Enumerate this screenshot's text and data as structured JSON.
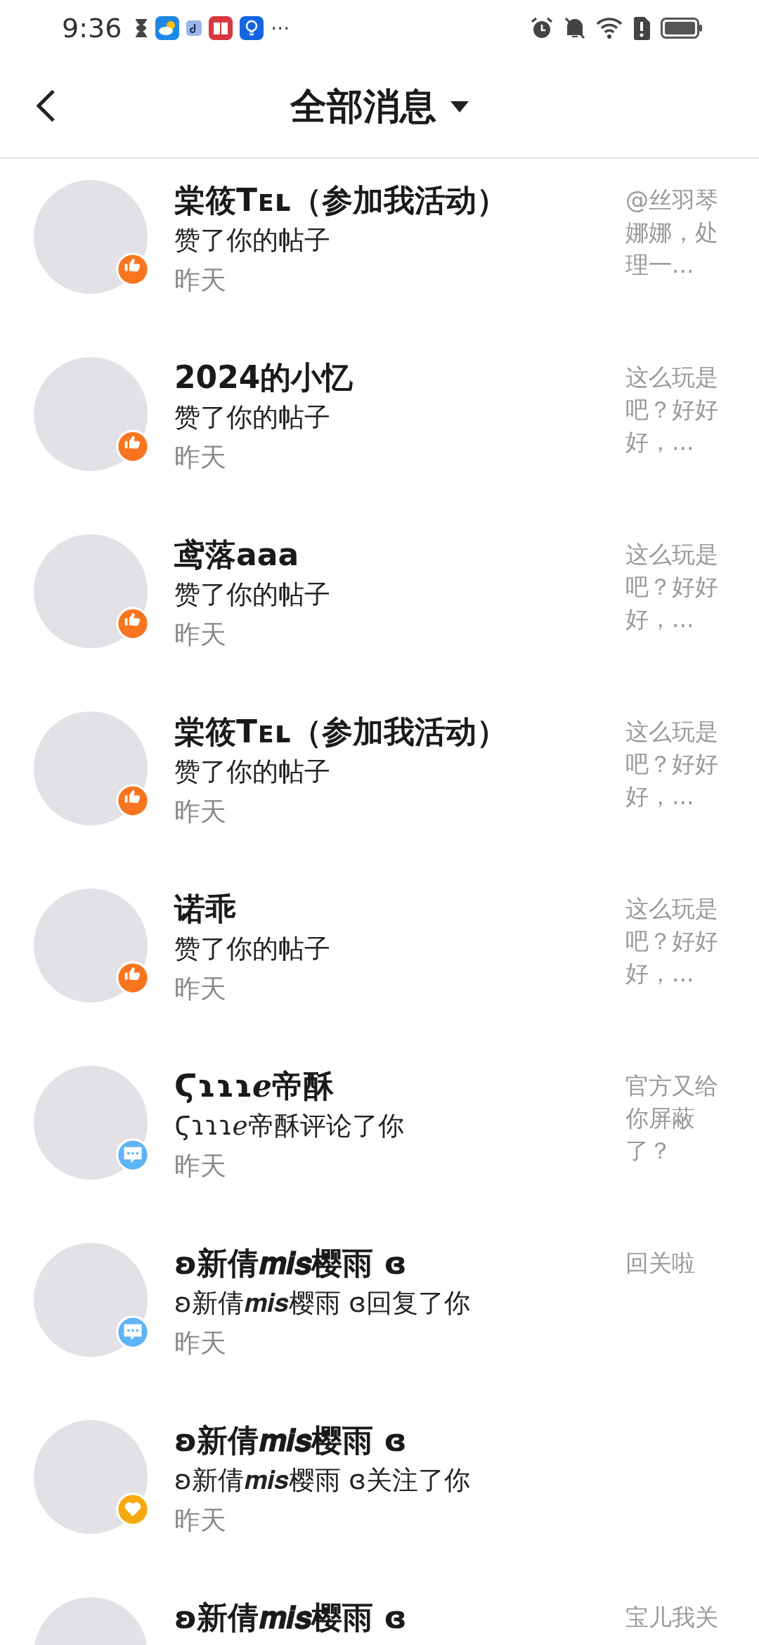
{
  "status_bar": {
    "time": "9:36",
    "more": "···"
  },
  "header": {
    "title": "全部消息"
  },
  "messages": [
    {
      "name": "棠筱Tᴇʟ（参加我活动）",
      "action": "赞了你的帖子",
      "time": "昨天",
      "preview": "@丝羽琴娜娜，处理一...",
      "kind": "like"
    },
    {
      "name": "2024的小忆",
      "action": "赞了你的帖子",
      "time": "昨天",
      "preview": "这么玩是吧？好好好，...",
      "kind": "like"
    },
    {
      "name": "鸢落aaa",
      "action": "赞了你的帖子",
      "time": "昨天",
      "preview": "这么玩是吧？好好好，...",
      "kind": "like"
    },
    {
      "name": "棠筱Tᴇʟ（参加我活动）",
      "action": "赞了你的帖子",
      "time": "昨天",
      "preview": "这么玩是吧？好好好，...",
      "kind": "like"
    },
    {
      "name": "诺乖",
      "action": "赞了你的帖子",
      "time": "昨天",
      "preview": "这么玩是吧？好好好，...",
      "kind": "like"
    },
    {
      "name": "Ϛɿɿɿℯ帝酥",
      "action": "Ϛɿɿɿℯ帝酥评论了你",
      "time": "昨天",
      "preview": "官方又给你屏蔽了？",
      "kind": "comment"
    },
    {
      "name": "ʚ新倩𝒎𝒊𝒔樱雨 ɞ",
      "action": "ʚ新倩𝒎𝒊𝒔樱雨 ɞ回复了你",
      "time": "昨天",
      "preview": "回关啦",
      "kind": "comment"
    },
    {
      "name": "ʚ新倩𝒎𝒊𝒔樱雨 ɞ",
      "action": "ʚ新倩𝒎𝒊𝒔樱雨 ɞ关注了你",
      "time": "昨天",
      "kind": "follow"
    },
    {
      "name": "ʚ新倩𝒎𝒊𝒔樱雨 ɞ",
      "preview": "宝儿我关"
    }
  ]
}
